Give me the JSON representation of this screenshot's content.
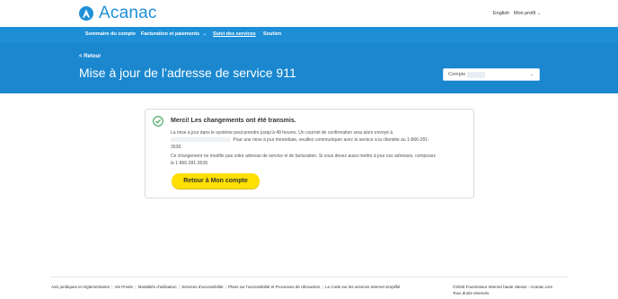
{
  "brand": {
    "name": "Acanac",
    "color": "#1e8fd6"
  },
  "header": {
    "language_link": "English",
    "profile_label": "Mon profil"
  },
  "nav": {
    "items": [
      {
        "label": "Sommaire du compte"
      },
      {
        "label": "Facturation et paiements",
        "has_dropdown": true
      },
      {
        "label": "Suivi des services",
        "active": true
      },
      {
        "label": "Soutien"
      }
    ]
  },
  "banner": {
    "back_label": "Retour",
    "title": "Mise à jour de l’adresse de service 911",
    "account_select": {
      "label": "Compte",
      "value_redacted": true
    }
  },
  "confirmation": {
    "title": "Merci! Les changements ont été transmis.",
    "paragraph1_a": "La mise à jour dans le système peut prendre jusqu’à 48 heures. Un courriel de confirmation sera alors envoyé à",
    "paragraph1_b": "Pour une mise à jour immédiate, veuillez communiquer avec le service à la clientèle au 1-866-281-3538.",
    "paragraph2": "Ce changement ne modifie pas votre adresse de service ni de facturation. Si vous devez aussi mettre à jour ces adresses, composez le 1-866-281-3538.",
    "button_label": "Retour à Mon compte",
    "button_color": "#ffe000"
  },
  "footer": {
    "links": [
      "Avis juridiques et réglementaires",
      "Vie Privée",
      "Modalités d’utilisation",
      "Services d’accessibilité",
      "Plans sur l’accessibilité et Processus de rétroaction",
      "Le Code sur les services Internet simplifié"
    ],
    "copyright_line1": "©2025 Fournisseur Internet haute vitesse - Acanac.com",
    "copyright_line2": "Tous droits réservés"
  }
}
